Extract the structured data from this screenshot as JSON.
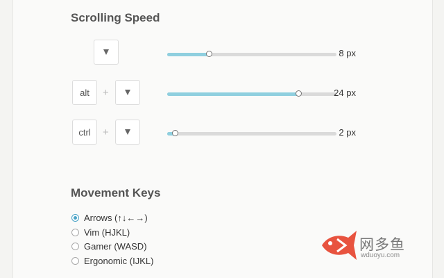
{
  "scrolling": {
    "title": "Scrolling Speed",
    "rows": [
      {
        "modifier": "",
        "value": 8,
        "unit": "px",
        "fraction": 0.25
      },
      {
        "modifier": "alt",
        "value": 24,
        "unit": "px",
        "fraction": 0.78
      },
      {
        "modifier": "ctrl",
        "value": 2,
        "unit": "px",
        "fraction": 0.05
      }
    ],
    "plus": "+",
    "dropdown_icon": "chevron-down-icon"
  },
  "movement": {
    "title": "Movement Keys",
    "options": [
      {
        "label": "Arrows (↑↓←→)",
        "checked": true
      },
      {
        "label": "Vim (HJKL)",
        "checked": false
      },
      {
        "label": "Gamer (WASD)",
        "checked": false
      },
      {
        "label": "Ergonomic (IJKL)",
        "checked": false
      }
    ]
  },
  "watermark": {
    "title": "网多鱼",
    "url": "wduoyu.com",
    "logo": "fish-logo-icon"
  },
  "colors": {
    "accent": "#8fcfdf",
    "radio": "#4aa3c7",
    "logo": "#e8533f"
  }
}
